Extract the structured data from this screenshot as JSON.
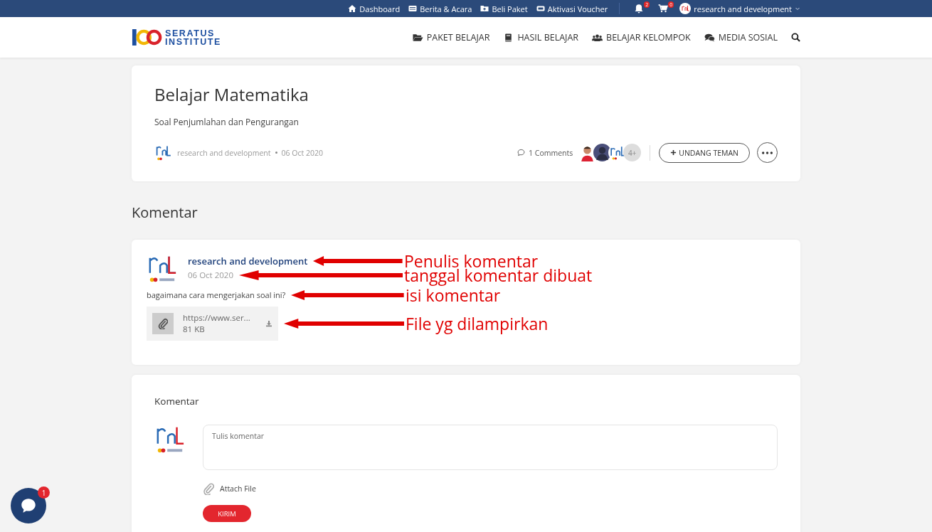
{
  "topbar": {
    "links": [
      {
        "label": "Dashboard"
      },
      {
        "label": "Berita & Acara"
      },
      {
        "label": "Beli Paket"
      },
      {
        "label": "Aktivasi Voucher"
      }
    ],
    "notifications": "2",
    "cart": "0",
    "user": "research and development"
  },
  "nav": {
    "logo_line1": "SERATUS",
    "logo_line2": "INSTITUTE",
    "items": [
      {
        "label": "PAKET BELAJAR"
      },
      {
        "label": "HASIL BELAJAR"
      },
      {
        "label": "BELAJAR KELOMPOK"
      },
      {
        "label": "MEDIA SOSIAL"
      }
    ]
  },
  "post": {
    "title": "Belajar Matematika",
    "subtitle": "Soal Penjumlahan dan Pengurangan",
    "author": "research and development",
    "date": "06 Oct 2020",
    "comments": "1 Comments",
    "more_members": "4+",
    "invite": "UNDANG TEMAN"
  },
  "comments_heading": "Komentar",
  "comment": {
    "author": "research and development",
    "date": "06 Oct 2020",
    "text": "bagaimana cara mengerjakan soal ini?",
    "file_name": "https://www.ser...",
    "file_size": "81 KB"
  },
  "annotations": [
    "Penulis komentar",
    "tanggal komentar dibuat",
    "isi komentar",
    "File yg dilampirkan"
  ],
  "form": {
    "title": "Komentar",
    "placeholder": "Tulis komentar",
    "attach": "Attach File",
    "submit": "KIRIM"
  },
  "chat_badge": "1"
}
